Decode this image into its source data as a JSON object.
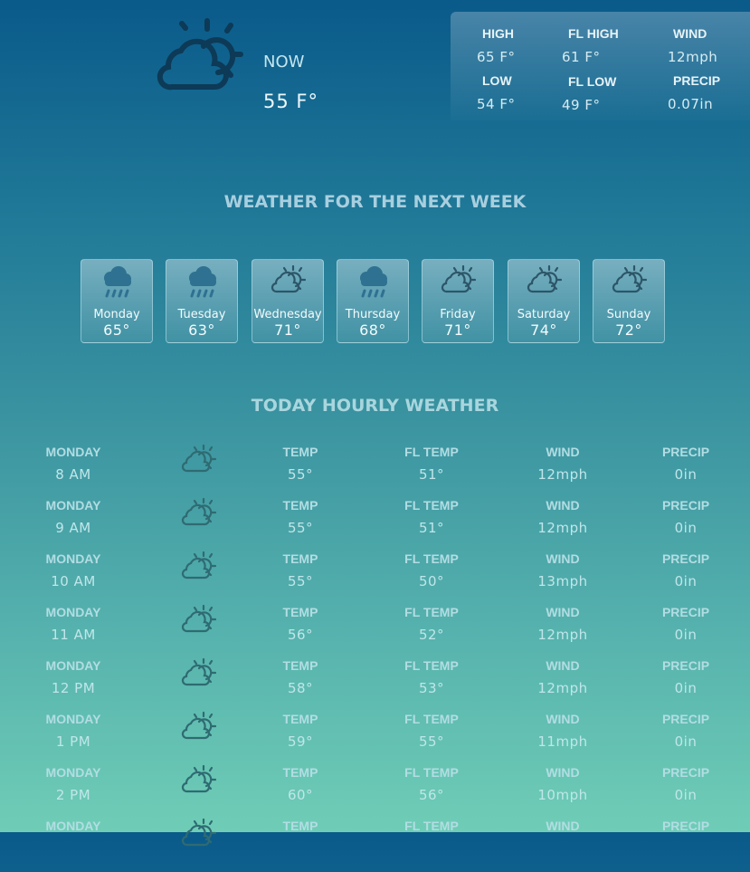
{
  "current": {
    "icon": "partly-cloudy-icon",
    "label": "NOW",
    "temp": "55 F°"
  },
  "stats": [
    {
      "label": "HIGH",
      "value": "65 F°"
    },
    {
      "label": "FL HIGH",
      "value": "61 F°"
    },
    {
      "label": "WIND",
      "value": "12mph"
    },
    {
      "label": "LOW",
      "value": "54 F°"
    },
    {
      "label": "FL LOW",
      "value": "49 F°"
    },
    {
      "label": "PRECIP",
      "value": "0.07in"
    }
  ],
  "week": {
    "title": "WEATHER FOR THE NEXT WEEK",
    "days": [
      {
        "name": "Monday",
        "temp": "65°",
        "icon": "rain-icon"
      },
      {
        "name": "Tuesday",
        "temp": "63°",
        "icon": "rain-icon"
      },
      {
        "name": "Wednesday",
        "temp": "71°",
        "icon": "partly-cloudy-icon"
      },
      {
        "name": "Thursday",
        "temp": "68°",
        "icon": "rain-icon"
      },
      {
        "name": "Friday",
        "temp": "71°",
        "icon": "partly-cloudy-icon"
      },
      {
        "name": "Saturday",
        "temp": "74°",
        "icon": "partly-cloudy-icon"
      },
      {
        "name": "Sunday",
        "temp": "72°",
        "icon": "partly-cloudy-icon"
      }
    ]
  },
  "hourly": {
    "title": "TODAY HOURLY WEATHER",
    "labels": {
      "temp": "TEMP",
      "fl_temp": "FL TEMP",
      "wind": "WIND",
      "precip": "PRECIP"
    },
    "rows": [
      {
        "day": "MONDAY",
        "time": "8 AM",
        "icon": "partly-cloudy-icon",
        "temp": "55°",
        "fl_temp": "51°",
        "wind": "12mph",
        "precip": "0in"
      },
      {
        "day": "MONDAY",
        "time": "9 AM",
        "icon": "partly-cloudy-icon",
        "temp": "55°",
        "fl_temp": "51°",
        "wind": "12mph",
        "precip": "0in"
      },
      {
        "day": "MONDAY",
        "time": "10 AM",
        "icon": "partly-cloudy-icon",
        "temp": "55°",
        "fl_temp": "50°",
        "wind": "13mph",
        "precip": "0in"
      },
      {
        "day": "MONDAY",
        "time": "11 AM",
        "icon": "partly-cloudy-icon",
        "temp": "56°",
        "fl_temp": "52°",
        "wind": "12mph",
        "precip": "0in"
      },
      {
        "day": "MONDAY",
        "time": "12 PM",
        "icon": "partly-cloudy-icon",
        "temp": "58°",
        "fl_temp": "53°",
        "wind": "12mph",
        "precip": "0in"
      },
      {
        "day": "MONDAY",
        "time": "1 PM",
        "icon": "partly-cloudy-icon",
        "temp": "59°",
        "fl_temp": "55°",
        "wind": "11mph",
        "precip": "0in"
      },
      {
        "day": "MONDAY",
        "time": "2 PM",
        "icon": "partly-cloudy-icon",
        "temp": "60°",
        "fl_temp": "56°",
        "wind": "10mph",
        "precip": "0in"
      },
      {
        "day": "MONDAY",
        "time": "",
        "icon": "partly-cloudy-icon",
        "temp": "",
        "fl_temp": "",
        "wind": "",
        "precip": ""
      }
    ]
  }
}
